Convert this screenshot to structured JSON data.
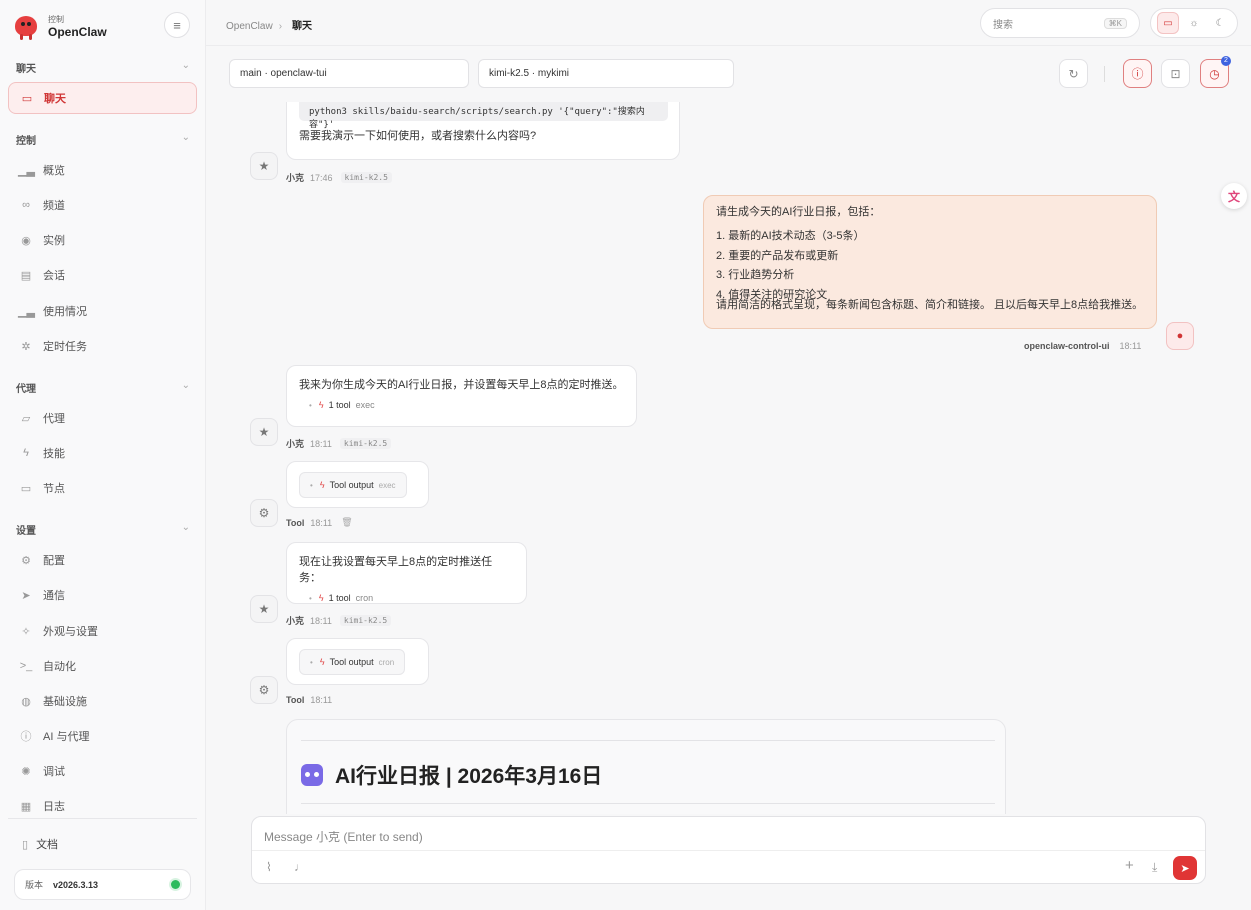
{
  "brand": {
    "sub": "控制",
    "name": "OpenClaw"
  },
  "sidebar": {
    "sections": [
      {
        "label": "聊天"
      },
      {
        "label": "控制"
      },
      {
        "label": "代理"
      },
      {
        "label": "设置"
      }
    ],
    "items": [
      {
        "label": "聊天",
        "icon": "message-icon"
      },
      {
        "label": "概览",
        "icon": "chart-icon"
      },
      {
        "label": "频道",
        "icon": "link-icon"
      },
      {
        "label": "实例",
        "icon": "broadcast-icon"
      },
      {
        "label": "会话",
        "icon": "file-icon"
      },
      {
        "label": "使用情况",
        "icon": "chart-icon"
      },
      {
        "label": "定时任务",
        "icon": "loader-icon"
      },
      {
        "label": "代理",
        "icon": "folder-icon"
      },
      {
        "label": "技能",
        "icon": "bolt-icon"
      },
      {
        "label": "节点",
        "icon": "monitor-icon"
      },
      {
        "label": "配置",
        "icon": "gear-icon"
      },
      {
        "label": "通信",
        "icon": "send-icon"
      },
      {
        "label": "外观与设置",
        "icon": "sparkle-icon"
      },
      {
        "label": "自动化",
        "icon": "terminal-icon"
      },
      {
        "label": "基础设施",
        "icon": "globe-icon"
      },
      {
        "label": "AI 与代理",
        "icon": "brain-icon"
      },
      {
        "label": "调试",
        "icon": "bug-icon"
      },
      {
        "label": "日志",
        "icon": "log-icon"
      }
    ],
    "docs": "文档",
    "version_label": "版本",
    "version": "v2026.3.13",
    "status_color": "#2dbb5d"
  },
  "topbar": {
    "breadcrumb_root": "OpenClaw",
    "breadcrumb_current": "聊天",
    "search_placeholder": "搜索",
    "search_shortcut": "⌘K"
  },
  "session": {
    "select": "main · openclaw-tui",
    "model": "kimi-k2.5 · mykimi",
    "badge": "2"
  },
  "messages": {
    "m0": {
      "code": "python3 skills/baidu-search/scripts/search.py '{\"query\":\"搜索内容\"}'",
      "text": "需要我演示一下如何使用，或者搜索什么内容吗?",
      "sender": "小克",
      "time": "17:46",
      "model": "kimi-k2.5"
    },
    "user": {
      "intro": "请生成今天的AI行业日报，包括：",
      "items": [
        "1. 最新的AI技术动态（3-5条）",
        "2. 重要的产品发布或更新",
        "3. 行业趋势分析",
        "4. 值得关注的研究论文"
      ],
      "outro": "请用简洁的格式呈现，每条新闻包含标题、简介和链接。 且以后每天早上8点给我推送。",
      "sender": "openclaw-control-ui",
      "time": "18:11"
    },
    "m1": {
      "text": "我来为你生成今天的AI行业日报，并设置每天早上8点的定时推送。",
      "tool_count": "1 tool",
      "tool_name": "exec",
      "sender": "小克",
      "time": "18:11",
      "model": "kimi-k2.5"
    },
    "t1": {
      "label": "Tool output",
      "tool_name": "exec",
      "sender": "Tool",
      "time": "18:11"
    },
    "m2": {
      "text": "现在让我设置每天早上8点的定时推送任务：",
      "tool_count": "1 tool",
      "tool_name": "cron",
      "sender": "小克",
      "time": "18:11",
      "model": "kimi-k2.5"
    },
    "t2": {
      "label": "Tool output",
      "tool_name": "cron",
      "sender": "Tool",
      "time": "18:11"
    },
    "report_title": "AI行业日报 | 2026年3月16日"
  },
  "composer": {
    "placeholder": "Message 小克 (Enter to send)"
  },
  "colors": {
    "accent": "#e03535",
    "user_bubble": "#fbe9df"
  }
}
